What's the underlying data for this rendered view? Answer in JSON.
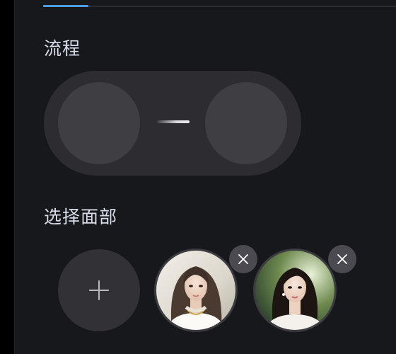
{
  "colors": {
    "panel_background": "#17181c",
    "accent": "#4d9de6",
    "title_text": "#d9dcea",
    "slot_background": "#3f3f43",
    "pill_background": "#2d2d31",
    "remove_button": "#4a4a50"
  },
  "tabs": {
    "active_indicator_color": "#4d9de6"
  },
  "flow": {
    "title": "流程",
    "source_slot_icon": "empty-circle",
    "target_slot_icon": "empty-circle",
    "connector_icon": "arrow-line"
  },
  "faces": {
    "title": "选择面部",
    "add_icon": "plus-icon",
    "remove_icon": "close-icon",
    "items": [
      {
        "kind": "face-photo",
        "description_icon": "portrait-photo-1"
      },
      {
        "kind": "face-photo",
        "description_icon": "portrait-photo-2"
      }
    ]
  }
}
